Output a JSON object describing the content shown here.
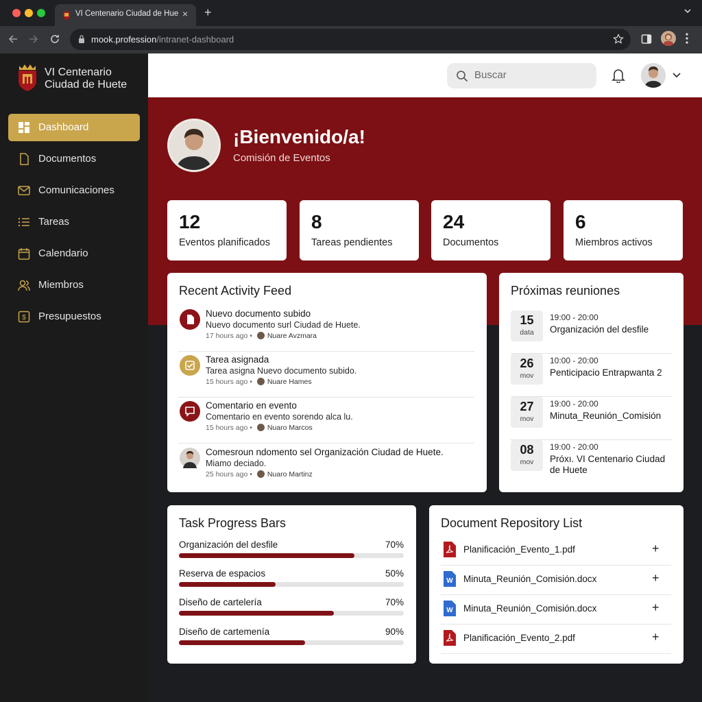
{
  "browser": {
    "tab_title": "VI Centenario Ciudad de Huete",
    "url_host": "mook.profession",
    "url_path": "/intranet-dashboard",
    "new_tab": "+",
    "tab_close": "×"
  },
  "sidebar": {
    "brand_line1": "VI Centenario",
    "brand_line2": "Ciudad de Huete",
    "items": [
      {
        "label": "Dashboard",
        "icon": "dashboard-icon",
        "active": true
      },
      {
        "label": "Documentos",
        "icon": "document-icon"
      },
      {
        "label": "Comunicaciones",
        "icon": "mail-icon"
      },
      {
        "label": "Tareas",
        "icon": "list-icon"
      },
      {
        "label": "Calendario",
        "icon": "calendar-icon"
      },
      {
        "label": "Miembros",
        "icon": "users-icon"
      },
      {
        "label": "Presupuestos",
        "icon": "budget-icon"
      }
    ]
  },
  "header": {
    "search_placeholder": "Buscar"
  },
  "hero": {
    "title": "¡Bienvenido/a!",
    "subtitle": "Comisión de Eventos"
  },
  "stats": [
    {
      "value": "12",
      "label": "Eventos planificados"
    },
    {
      "value": "8",
      "label": "Tareas pendientes"
    },
    {
      "value": "24",
      "label": "Documentos"
    },
    {
      "value": "6",
      "label": "Miembros activos"
    }
  ],
  "activity": {
    "title": "Recent Activity Feed",
    "items": [
      {
        "title": "Nuevo documento subido",
        "desc": "Nuevo documento surl Ciudad de Huete.",
        "time": "17 hours ago",
        "user": "Nuare Avzmara",
        "icon": "document-icon",
        "color": "#8b1418"
      },
      {
        "title": "Tarea asignada",
        "desc": "Tarea asigna Nuevo documento subido.",
        "time": "15 hours ago",
        "user": "Nuare Hames",
        "icon": "task-check-icon",
        "color": "#c9a54c"
      },
      {
        "title": "Comentario en evento",
        "desc": "Comentario en evento sorendo alca lu.",
        "time": "15 hours ago",
        "user": "Nuaro Marcos",
        "icon": "comment-icon",
        "color": "#8b1418"
      },
      {
        "title": "Comesroun ndomento sel Organización Ciudad de Huete.",
        "desc": "Miamo deciado.",
        "time": "25 hours ago",
        "user": "Nuaro Martinz",
        "icon": "avatar-icon",
        "color": "#d6d1cb"
      }
    ]
  },
  "meetings": {
    "title": "Próximas reuniones",
    "items": [
      {
        "day": "15",
        "month": "data",
        "time": "19:00 - 20:00",
        "title": "Organización del desfile"
      },
      {
        "day": "26",
        "month": "mov",
        "time": "10:00 - 20:00",
        "title": "Penticipacio Entrapwanta 2"
      },
      {
        "day": "27",
        "month": "mov",
        "time": "19:00 - 20:00",
        "title": "Minuta_Reunión_Comisión"
      },
      {
        "day": "08",
        "month": "mov",
        "time": "19:00 - 20:00",
        "title": "Próxı. VI Centenario Ciudad de Huete"
      }
    ]
  },
  "progress": {
    "title": "Task Progress Bars",
    "items": [
      {
        "label": "Organización del desfile",
        "pct_text": "70%",
        "fill": 0.78
      },
      {
        "label": "Reserva de espacios",
        "pct_text": "50%",
        "fill": 0.43
      },
      {
        "label": "Diseño de cartelería",
        "pct_text": "70%",
        "fill": 0.69
      },
      {
        "label": "Diseño de cartemenía",
        "pct_text": "90%",
        "fill": 0.56
      }
    ]
  },
  "documents": {
    "title": "Document Repository List",
    "items": [
      {
        "name": "Planificación_Evento_1.pdf",
        "type": "pdf"
      },
      {
        "name": "Minuta_Reunión_Comisión.docx",
        "type": "word"
      },
      {
        "name": "Minuta_Reunión_Comisión.docx",
        "type": "word"
      },
      {
        "name": "Planificación_Evento_2.pdf",
        "type": "pdf"
      }
    ],
    "add_symbol": "+"
  },
  "colors": {
    "accent_gold": "#c9a54c",
    "brand_red": "#7d1014",
    "sidebar_bg": "#1b1b1b"
  }
}
